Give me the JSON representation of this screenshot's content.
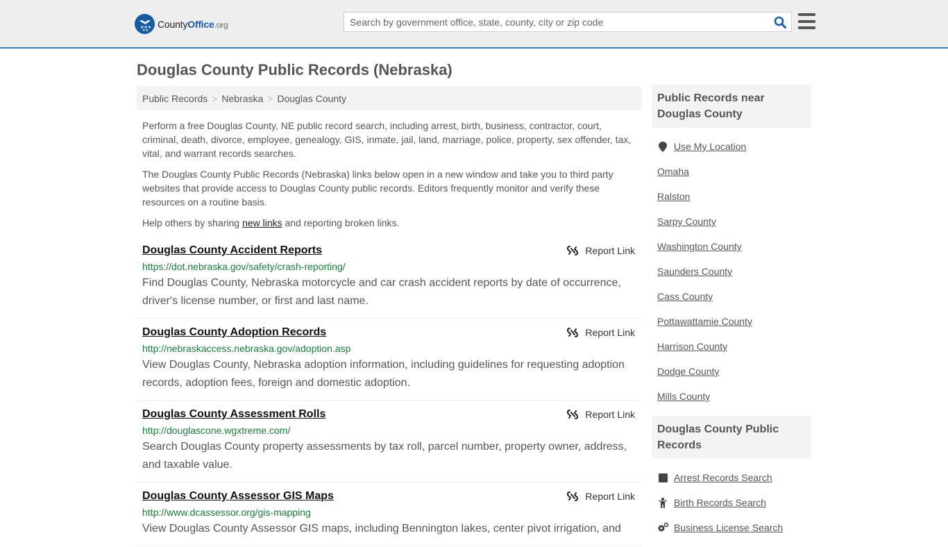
{
  "header": {
    "logo": {
      "county": "County",
      "office": "Office",
      "org": ".org"
    },
    "search_placeholder": "Search by government office, state, county, city or zip code",
    "search_icon": "search-icon",
    "menu_icon": "hamburger-menu-icon"
  },
  "page_title": "Douglas County Public Records (Nebraska)",
  "breadcrumb": [
    {
      "label": "Public Records"
    },
    {
      "label": "Nebraska"
    },
    {
      "label": "Douglas County"
    }
  ],
  "breadcrumb_separator": ">",
  "intro": {
    "p1": "Perform a free Douglas County, NE public record search, including arrest, birth, business, contractor, court, criminal, death, divorce, employee, genealogy, GIS, inmate, jail, land, marriage, police, property, sex offender, tax, vital, and warrant records searches.",
    "p2": "The Douglas County Public Records (Nebraska) links below open in a new window and take you to third party websites that provide access to Douglas County public records. Editors frequently monitor and verify these resources on a routine basis.",
    "p3_before": "Help others by sharing ",
    "p3_link": "new links",
    "p3_after": " and reporting broken links."
  },
  "report_link_label": "Report Link",
  "records": [
    {
      "title": "Douglas County Accident Reports",
      "url": "https://dot.nebraska.gov/safety/crash-reporting/",
      "description": "Find Douglas County, Nebraska motorcycle and car crash accident reports by date of occurrence, driver's license number, or first and last name."
    },
    {
      "title": "Douglas County Adoption Records",
      "url": "http://nebraskaccess.nebraska.gov/adoption.asp",
      "description": "View Douglas County, Nebraska adoption information, including guidelines for requesting adoption records, adoption fees, foreign and domestic adoption."
    },
    {
      "title": "Douglas County Assessment Rolls",
      "url": "http://douglascone.wgxtreme.com/",
      "description": "Search Douglas County property assessments by tax roll, parcel number, property owner, address, and taxable value."
    },
    {
      "title": "Douglas County Assessor GIS Maps",
      "url": "http://www.dcassessor.org/gis-mapping",
      "description": "View Douglas County Assessor GIS maps, including Bennington lakes, center pivot irrigation, and"
    }
  ],
  "sidebar": {
    "nearby_heading": "Public Records near Douglas County",
    "use_location": "Use My Location",
    "nearby": [
      "Omaha",
      "Ralston",
      "Sarpy County",
      "Washington County",
      "Saunders County",
      "Cass County",
      "Pottawattamie County",
      "Harrison County",
      "Dodge County",
      "Mills County"
    ],
    "records_heading": "Douglas County Public Records",
    "record_links": [
      {
        "label": "Arrest Records Search",
        "icon": "square-icon"
      },
      {
        "label": "Birth Records Search",
        "icon": "child-icon"
      },
      {
        "label": "Business License Search",
        "icon": "gears-icon"
      }
    ]
  }
}
